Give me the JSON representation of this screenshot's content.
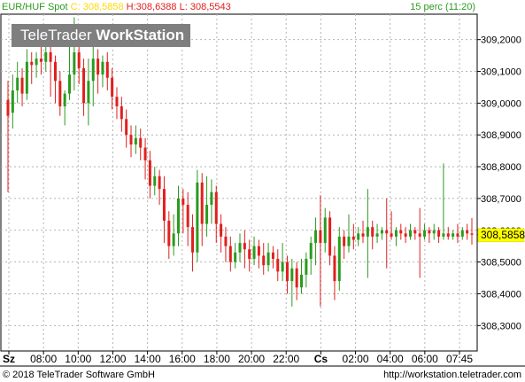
{
  "header": {
    "symbol": "EUR/HUF Spot",
    "close_label": "C:",
    "close": "308,5858",
    "high_label": "H:",
    "high": "308,6388",
    "low_label": "L:",
    "low": "308,5543",
    "interval": "15 perc (11:20)"
  },
  "watermark": {
    "brand": "TeleTrader",
    "product": "WorkStation"
  },
  "footer": {
    "copyright": "© 2018 TeleTrader Software GmbH",
    "url": "http://workstation.teletrader.com"
  },
  "colors": {
    "up": "#2a9b1e",
    "down": "#e0201e",
    "close_marker": "#ffff00",
    "header_close": "#ffd800",
    "header_high_low": "#e0201e",
    "interval": "#2a9b1e"
  },
  "chart_data": {
    "type": "candlestick",
    "y_ticks": [
      "309,2000",
      "309,1000",
      "309,0000",
      "308,9000",
      "308,8000",
      "308,7000",
      "308,6000",
      "308,5000",
      "308,4000",
      "308,3000"
    ],
    "y_tick_values": [
      309.2,
      309.1,
      309.0,
      308.9,
      308.8,
      308.7,
      308.6,
      308.5,
      308.4,
      308.3
    ],
    "ylim": [
      308.22,
      309.28
    ],
    "x_labels": [
      "Sz",
      "08:00",
      "10:00",
      "12:00",
      "14:00",
      "16:00",
      "18:00",
      "20:00",
      "22:00",
      "Cs",
      "02:00",
      "04:00",
      "06:00",
      "07:45"
    ],
    "last_value": "308,5858",
    "last_value_num": 308.5858,
    "grid": true,
    "candles": [
      [
        309.01,
        308.96,
        309.07,
        308.72
      ],
      [
        308.97,
        309.04,
        309.09,
        308.92
      ],
      [
        309.04,
        309.08,
        309.13,
        309.0
      ],
      [
        309.08,
        309.03,
        309.11,
        308.99
      ],
      [
        309.03,
        309.13,
        309.17,
        309.01
      ],
      [
        309.13,
        309.12,
        309.16,
        309.06
      ],
      [
        309.12,
        309.14,
        309.16,
        309.08
      ],
      [
        309.14,
        309.13,
        309.19,
        309.09
      ],
      [
        309.13,
        309.16,
        309.19,
        309.1
      ],
      [
        309.16,
        309.13,
        309.2,
        309.02
      ],
      [
        309.13,
        309.07,
        309.15,
        309.0
      ],
      [
        309.07,
        308.99,
        309.1,
        308.96
      ],
      [
        308.99,
        309.03,
        309.04,
        308.93
      ],
      [
        309.03,
        309.09,
        309.19,
        309.01
      ],
      [
        309.09,
        309.16,
        309.27,
        309.04
      ],
      [
        309.16,
        309.11,
        309.2,
        309.06
      ],
      [
        309.11,
        309.0,
        309.14,
        308.96
      ],
      [
        309.0,
        309.07,
        309.14,
        308.93
      ],
      [
        309.07,
        309.14,
        309.22,
        308.99
      ],
      [
        309.14,
        309.09,
        309.17,
        309.03
      ],
      [
        309.09,
        309.13,
        309.15,
        309.05
      ],
      [
        309.13,
        309.08,
        309.16,
        309.04
      ],
      [
        309.08,
        309.02,
        309.11,
        308.98
      ],
      [
        309.02,
        308.99,
        309.05,
        308.95
      ],
      [
        308.99,
        308.95,
        309.02,
        308.91
      ],
      [
        308.95,
        308.9,
        308.98,
        308.86
      ],
      [
        308.9,
        308.87,
        308.93,
        308.83
      ],
      [
        308.87,
        308.89,
        308.93,
        308.84
      ],
      [
        308.89,
        308.86,
        308.92,
        308.82
      ],
      [
        308.86,
        308.82,
        308.89,
        308.76
      ],
      [
        308.82,
        308.74,
        308.85,
        308.7
      ],
      [
        308.74,
        308.77,
        308.8,
        308.71
      ],
      [
        308.77,
        308.73,
        308.79,
        308.68
      ],
      [
        308.73,
        308.63,
        308.77,
        308.56
      ],
      [
        308.63,
        308.55,
        308.66,
        308.51
      ],
      [
        308.55,
        308.59,
        308.65,
        308.52
      ],
      [
        308.59,
        308.7,
        308.74,
        308.55
      ],
      [
        308.7,
        308.68,
        308.73,
        308.59
      ],
      [
        308.68,
        308.61,
        308.72,
        308.55
      ],
      [
        308.61,
        308.53,
        308.65,
        308.47
      ],
      [
        308.53,
        308.75,
        308.79,
        308.5
      ],
      [
        308.75,
        308.62,
        308.78,
        308.55
      ],
      [
        308.62,
        308.68,
        308.77,
        308.58
      ],
      [
        308.68,
        308.72,
        308.76,
        308.62
      ],
      [
        308.72,
        308.62,
        308.74,
        308.56
      ],
      [
        308.62,
        308.58,
        308.65,
        308.53
      ],
      [
        308.58,
        308.55,
        308.61,
        308.5
      ],
      [
        308.55,
        308.5,
        308.58,
        308.47
      ],
      [
        308.5,
        308.53,
        308.56,
        308.48
      ],
      [
        308.53,
        308.56,
        308.59,
        308.5
      ],
      [
        308.56,
        308.54,
        308.6,
        308.48
      ],
      [
        308.54,
        308.51,
        308.57,
        308.47
      ],
      [
        308.51,
        308.55,
        308.58,
        308.49
      ],
      [
        308.55,
        308.52,
        308.57,
        308.48
      ],
      [
        308.52,
        308.49,
        308.56,
        308.46
      ],
      [
        308.49,
        308.53,
        308.56,
        308.47
      ],
      [
        308.53,
        308.51,
        308.55,
        308.48
      ],
      [
        308.51,
        308.47,
        308.54,
        308.44
      ],
      [
        308.47,
        308.5,
        308.56,
        308.44
      ],
      [
        308.5,
        308.44,
        308.52,
        308.4
      ],
      [
        308.44,
        308.48,
        308.51,
        308.36
      ],
      [
        308.48,
        308.42,
        308.5,
        308.38
      ],
      [
        308.42,
        308.46,
        308.51,
        308.4
      ],
      [
        308.46,
        308.51,
        308.53,
        308.42
      ],
      [
        308.51,
        308.56,
        308.58,
        308.46
      ],
      [
        308.56,
        308.6,
        308.64,
        308.49
      ],
      [
        308.6,
        308.56,
        308.71,
        308.36
      ],
      [
        308.56,
        308.64,
        308.67,
        308.53
      ],
      [
        308.64,
        308.52,
        308.66,
        308.49
      ],
      [
        308.52,
        308.44,
        308.55,
        308.38
      ],
      [
        308.44,
        308.58,
        308.61,
        308.41
      ],
      [
        308.58,
        308.55,
        308.6,
        308.51
      ],
      [
        308.55,
        308.58,
        308.65,
        308.53
      ],
      [
        308.58,
        308.57,
        308.62,
        308.54
      ],
      [
        308.57,
        308.59,
        308.61,
        308.55
      ],
      [
        308.59,
        308.58,
        308.63,
        308.56
      ],
      [
        308.58,
        308.61,
        308.73,
        308.45
      ],
      [
        308.61,
        308.58,
        308.63,
        308.54
      ],
      [
        308.58,
        308.59,
        308.62,
        308.56
      ],
      [
        308.59,
        308.6,
        308.61,
        308.57
      ],
      [
        308.6,
        308.59,
        308.7,
        308.48
      ],
      [
        308.59,
        308.58,
        308.66,
        308.57
      ],
      [
        308.58,
        308.6,
        308.61,
        308.55
      ],
      [
        308.6,
        308.59,
        308.62,
        308.57
      ],
      [
        308.59,
        308.58,
        308.61,
        308.56
      ],
      [
        308.58,
        308.6,
        308.62,
        308.57
      ],
      [
        308.6,
        308.59,
        308.61,
        308.57
      ],
      [
        308.59,
        308.58,
        308.67,
        308.45
      ],
      [
        308.58,
        308.6,
        308.62,
        308.57
      ],
      [
        308.6,
        308.59,
        308.61,
        308.56
      ],
      [
        308.59,
        308.6,
        308.62,
        308.57
      ],
      [
        308.6,
        308.58,
        308.61,
        308.56
      ],
      [
        308.58,
        308.59,
        308.81,
        308.57
      ],
      [
        308.59,
        308.58,
        308.61,
        308.57
      ],
      [
        308.58,
        308.59,
        308.6,
        308.57
      ],
      [
        308.59,
        308.58,
        308.62,
        308.56
      ],
      [
        308.58,
        308.6,
        308.61,
        308.57
      ],
      [
        308.6,
        308.59,
        308.62,
        308.57
      ],
      [
        308.59,
        308.5858,
        308.6388,
        308.5543
      ]
    ]
  }
}
